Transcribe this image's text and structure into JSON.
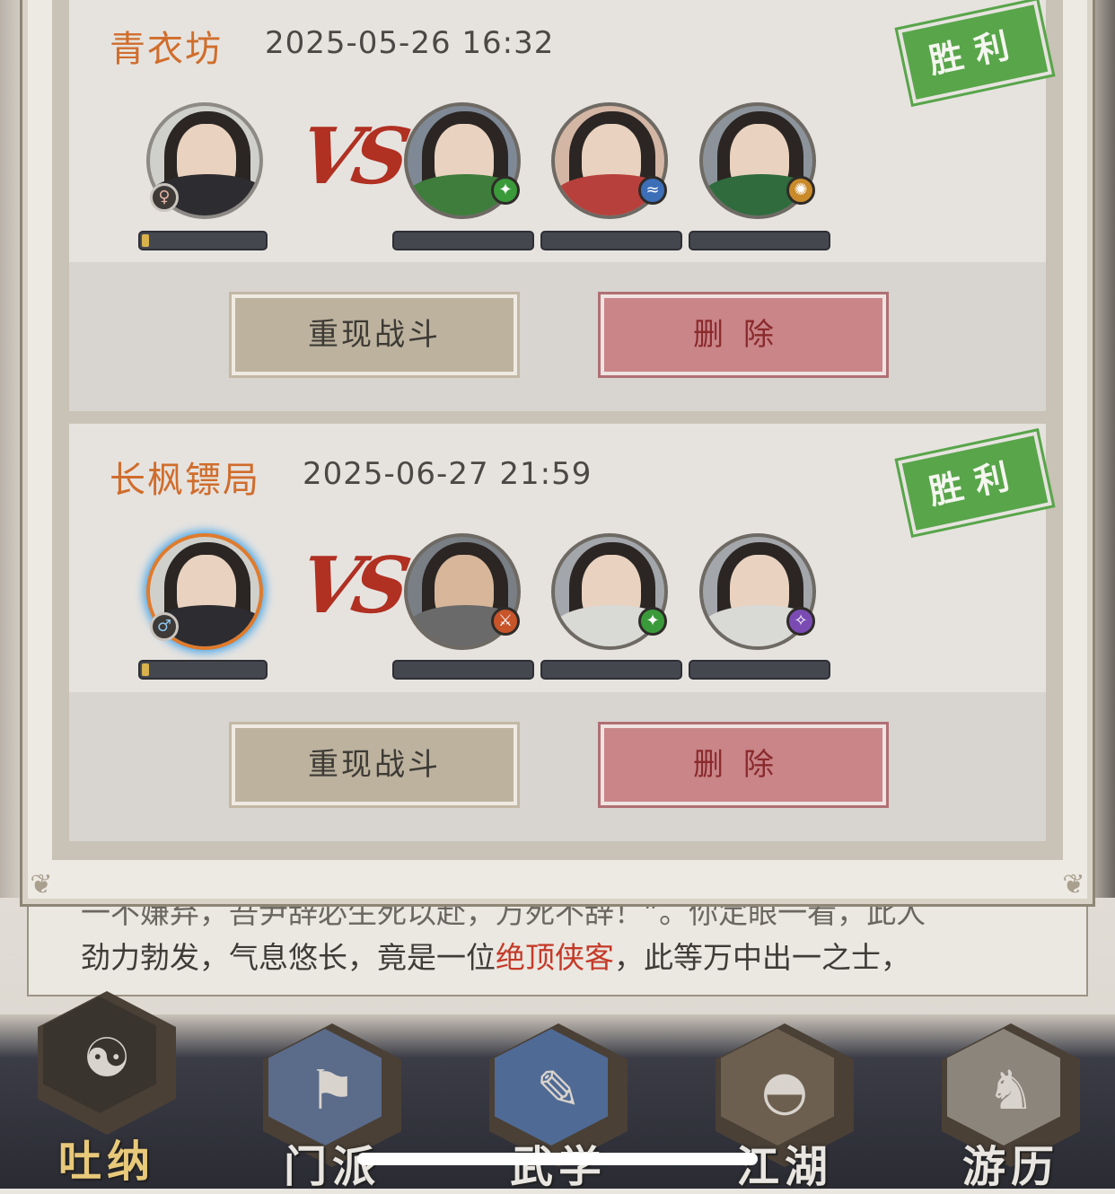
{
  "story": {
    "line1": "一不嫌弃，吾尹辞必生死以赴，万死不辞！”。你定眼一看，此人",
    "line2_pre": "劲力勃发，气息悠长，竟是一位",
    "line2_highlight": "绝顶侠客",
    "line2_post": "，此等万中出一之士，"
  },
  "records": [
    {
      "guild": "青衣坊",
      "datetime": "2025-05-26 16:32",
      "result": "胜利",
      "player_gender_icon": "female-icon",
      "player_gender_glyph": "♀",
      "vs": "VS",
      "opponents": [
        {
          "badge_icon": "sword-icon",
          "badge_color": "#3a9a3a",
          "robe": "#3e7d3b"
        },
        {
          "badge_icon": "water-icon",
          "badge_color": "#3d6fb8",
          "robe": "#b8403c"
        },
        {
          "badge_icon": "fire-icon",
          "badge_color": "#c98a2a",
          "robe": "#2f6b3c"
        }
      ],
      "replay_label": "重现战斗",
      "delete_label": "删除"
    },
    {
      "guild": "长枫镖局",
      "datetime": "2025-06-27 21:59",
      "result": "胜利",
      "player_gender_icon": "male-icon",
      "player_gender_glyph": "♂",
      "vs": "VS",
      "opponents": [
        {
          "badge_icon": "blade-icon",
          "badge_color": "#c8542a",
          "robe": "#6a6a6a"
        },
        {
          "badge_icon": "sword-icon",
          "badge_color": "#3a9a3a",
          "robe": "#d9d9d6"
        },
        {
          "badge_icon": "spear-icon",
          "badge_color": "#7a4bb3",
          "robe": "#d9d9d6"
        }
      ],
      "replay_label": "重现战斗",
      "delete_label": "删除"
    }
  ],
  "nav": [
    {
      "label": "吐纳",
      "icon": "meditation-icon",
      "active": true
    },
    {
      "label": "门派",
      "icon": "banner-icon",
      "active": false
    },
    {
      "label": "武学",
      "icon": "scroll-icon",
      "active": false
    },
    {
      "label": "江湖",
      "icon": "hat-icon",
      "active": false
    },
    {
      "label": "游历",
      "icon": "horse-icon",
      "active": false
    }
  ]
}
